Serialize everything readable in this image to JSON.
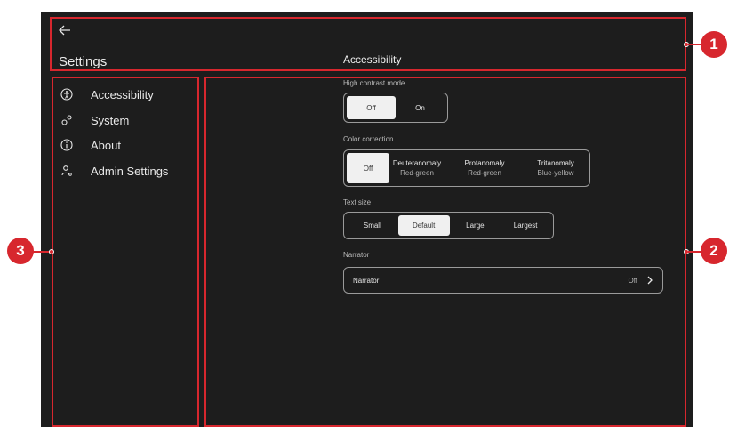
{
  "header": {
    "back_icon": "arrow-left-icon",
    "app_title": "Settings",
    "page_title": "Accessibility"
  },
  "sidebar": {
    "items": [
      {
        "label": "Accessibility",
        "icon": "accessibility-icon"
      },
      {
        "label": "System",
        "icon": "gears-icon"
      },
      {
        "label": "About",
        "icon": "info-icon"
      },
      {
        "label": "Admin Settings",
        "icon": "admin-user-icon"
      }
    ]
  },
  "main": {
    "high_contrast": {
      "label": "High contrast mode",
      "options": [
        {
          "label": "Off",
          "selected": true
        },
        {
          "label": "On",
          "selected": false
        }
      ]
    },
    "color_correction": {
      "label": "Color correction",
      "options": [
        {
          "label": "Off",
          "sub": "",
          "selected": true
        },
        {
          "label": "Deuteranomaly",
          "sub": "Red-green",
          "selected": false
        },
        {
          "label": "Protanomaly",
          "sub": "Red-green",
          "selected": false
        },
        {
          "label": "Tritanomaly",
          "sub": "Blue-yellow",
          "selected": false
        }
      ]
    },
    "text_size": {
      "label": "Text size",
      "options": [
        {
          "label": "Small",
          "selected": false
        },
        {
          "label": "Default",
          "selected": true
        },
        {
          "label": "Large",
          "selected": false
        },
        {
          "label": "Largest",
          "selected": false
        }
      ]
    },
    "narrator": {
      "section_label": "Narrator",
      "row_label": "Narrator",
      "value": "Off",
      "chevron_icon": "chevron-right-icon"
    }
  },
  "callouts": [
    "1",
    "2",
    "3"
  ],
  "colors": {
    "callout": "#d7272e",
    "background": "#1d1d1d",
    "selected_segment": "#f0f0f0"
  }
}
